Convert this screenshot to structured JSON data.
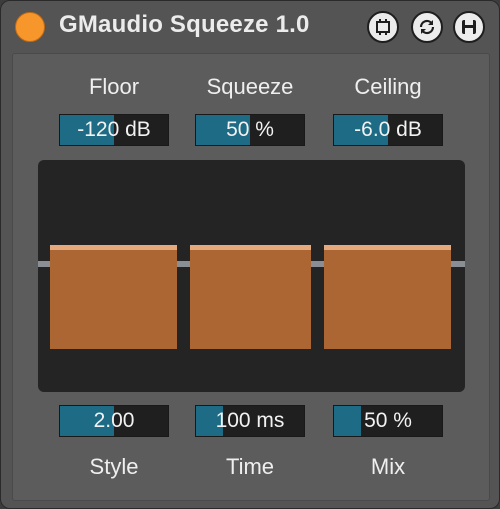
{
  "header": {
    "title": "GMaudio Squeeze 1.0",
    "power_on": true,
    "buttons": [
      "hot-swap-icon",
      "refresh-icon",
      "save-icon"
    ]
  },
  "colors": {
    "accent_orange": "#f7962b",
    "value_fill": "#1d6b85",
    "bar": "#ab6633",
    "bar_cap": "#e5a97c"
  },
  "params": {
    "floor": {
      "label": "Floor",
      "value": "-120 dB",
      "level": 0.5
    },
    "squeeze": {
      "label": "Squeeze",
      "value": "50 %",
      "level": 0.5
    },
    "ceiling": {
      "label": "Ceiling",
      "value": "-6.0 dB",
      "level": 0.5
    },
    "style": {
      "label": "Style",
      "value": "2.00",
      "level": 0.5
    },
    "time": {
      "label": "Time",
      "value": "100 ms",
      "level": 0.25
    },
    "mix": {
      "label": "Mix",
      "value": "50 %",
      "level": 0.25
    }
  },
  "display": {
    "bars": [
      {
        "name": "bar-left",
        "level": 0.55
      },
      {
        "name": "bar-middle",
        "level": 0.55
      },
      {
        "name": "bar-right",
        "level": 0.55
      }
    ]
  }
}
